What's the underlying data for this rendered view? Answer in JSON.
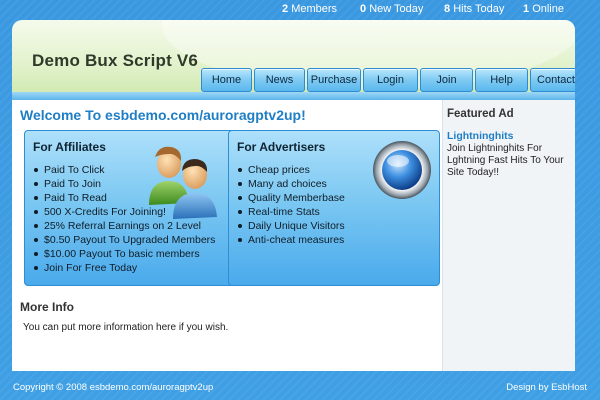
{
  "stats": {
    "members_count": "2",
    "members_label": "Members",
    "new_count": "0",
    "new_label": "New Today",
    "hits_count": "8",
    "hits_label": "Hits Today",
    "online_count": "1",
    "online_label": "Online"
  },
  "header": {
    "title": "Demo Bux Script V6",
    "nav": [
      "Home",
      "News",
      "Purchase",
      "Login",
      "Join",
      "Help",
      "Contact"
    ]
  },
  "main": {
    "welcome": "Welcome To esbdemo.com/auroragptv2up!",
    "affiliates": {
      "title": "For Affiliates",
      "icon": "people-icon",
      "items": [
        "Paid To Click",
        "Paid To Join",
        "Paid To Read",
        "500 X-Credits For Joining!",
        "25% Referral Earnings on 2 Level",
        "$0.50 Payout To Upgraded Members",
        "$10.00 Payout To basic members",
        "Join For Free Today"
      ]
    },
    "advertisers": {
      "title": "For Advertisers",
      "icon": "orb-icon",
      "items": [
        "Cheap prices",
        "Many ad choices",
        "Quality Memberbase",
        "Real-time Stats",
        "Daily Unique Visitors",
        "Anti-cheat measures"
      ]
    },
    "more_info": {
      "title": "More Info",
      "text": "You can put more information here if you wish."
    }
  },
  "sidebar": {
    "featured_title": "Featured Ad",
    "ad_link": "Lightninghits",
    "ad_text": "Join Lightninghits For Lghtning Fast Hits To Your Site Today!!"
  },
  "footer": {
    "copyright": "Copyright © 2008 esbdemo.com/auroragptv2up",
    "design": "Design by EsbHost"
  },
  "colors": {
    "background": "#3f9fe4",
    "accent_blue": "#1f7ec4",
    "header_green": "#e3f2cd"
  }
}
